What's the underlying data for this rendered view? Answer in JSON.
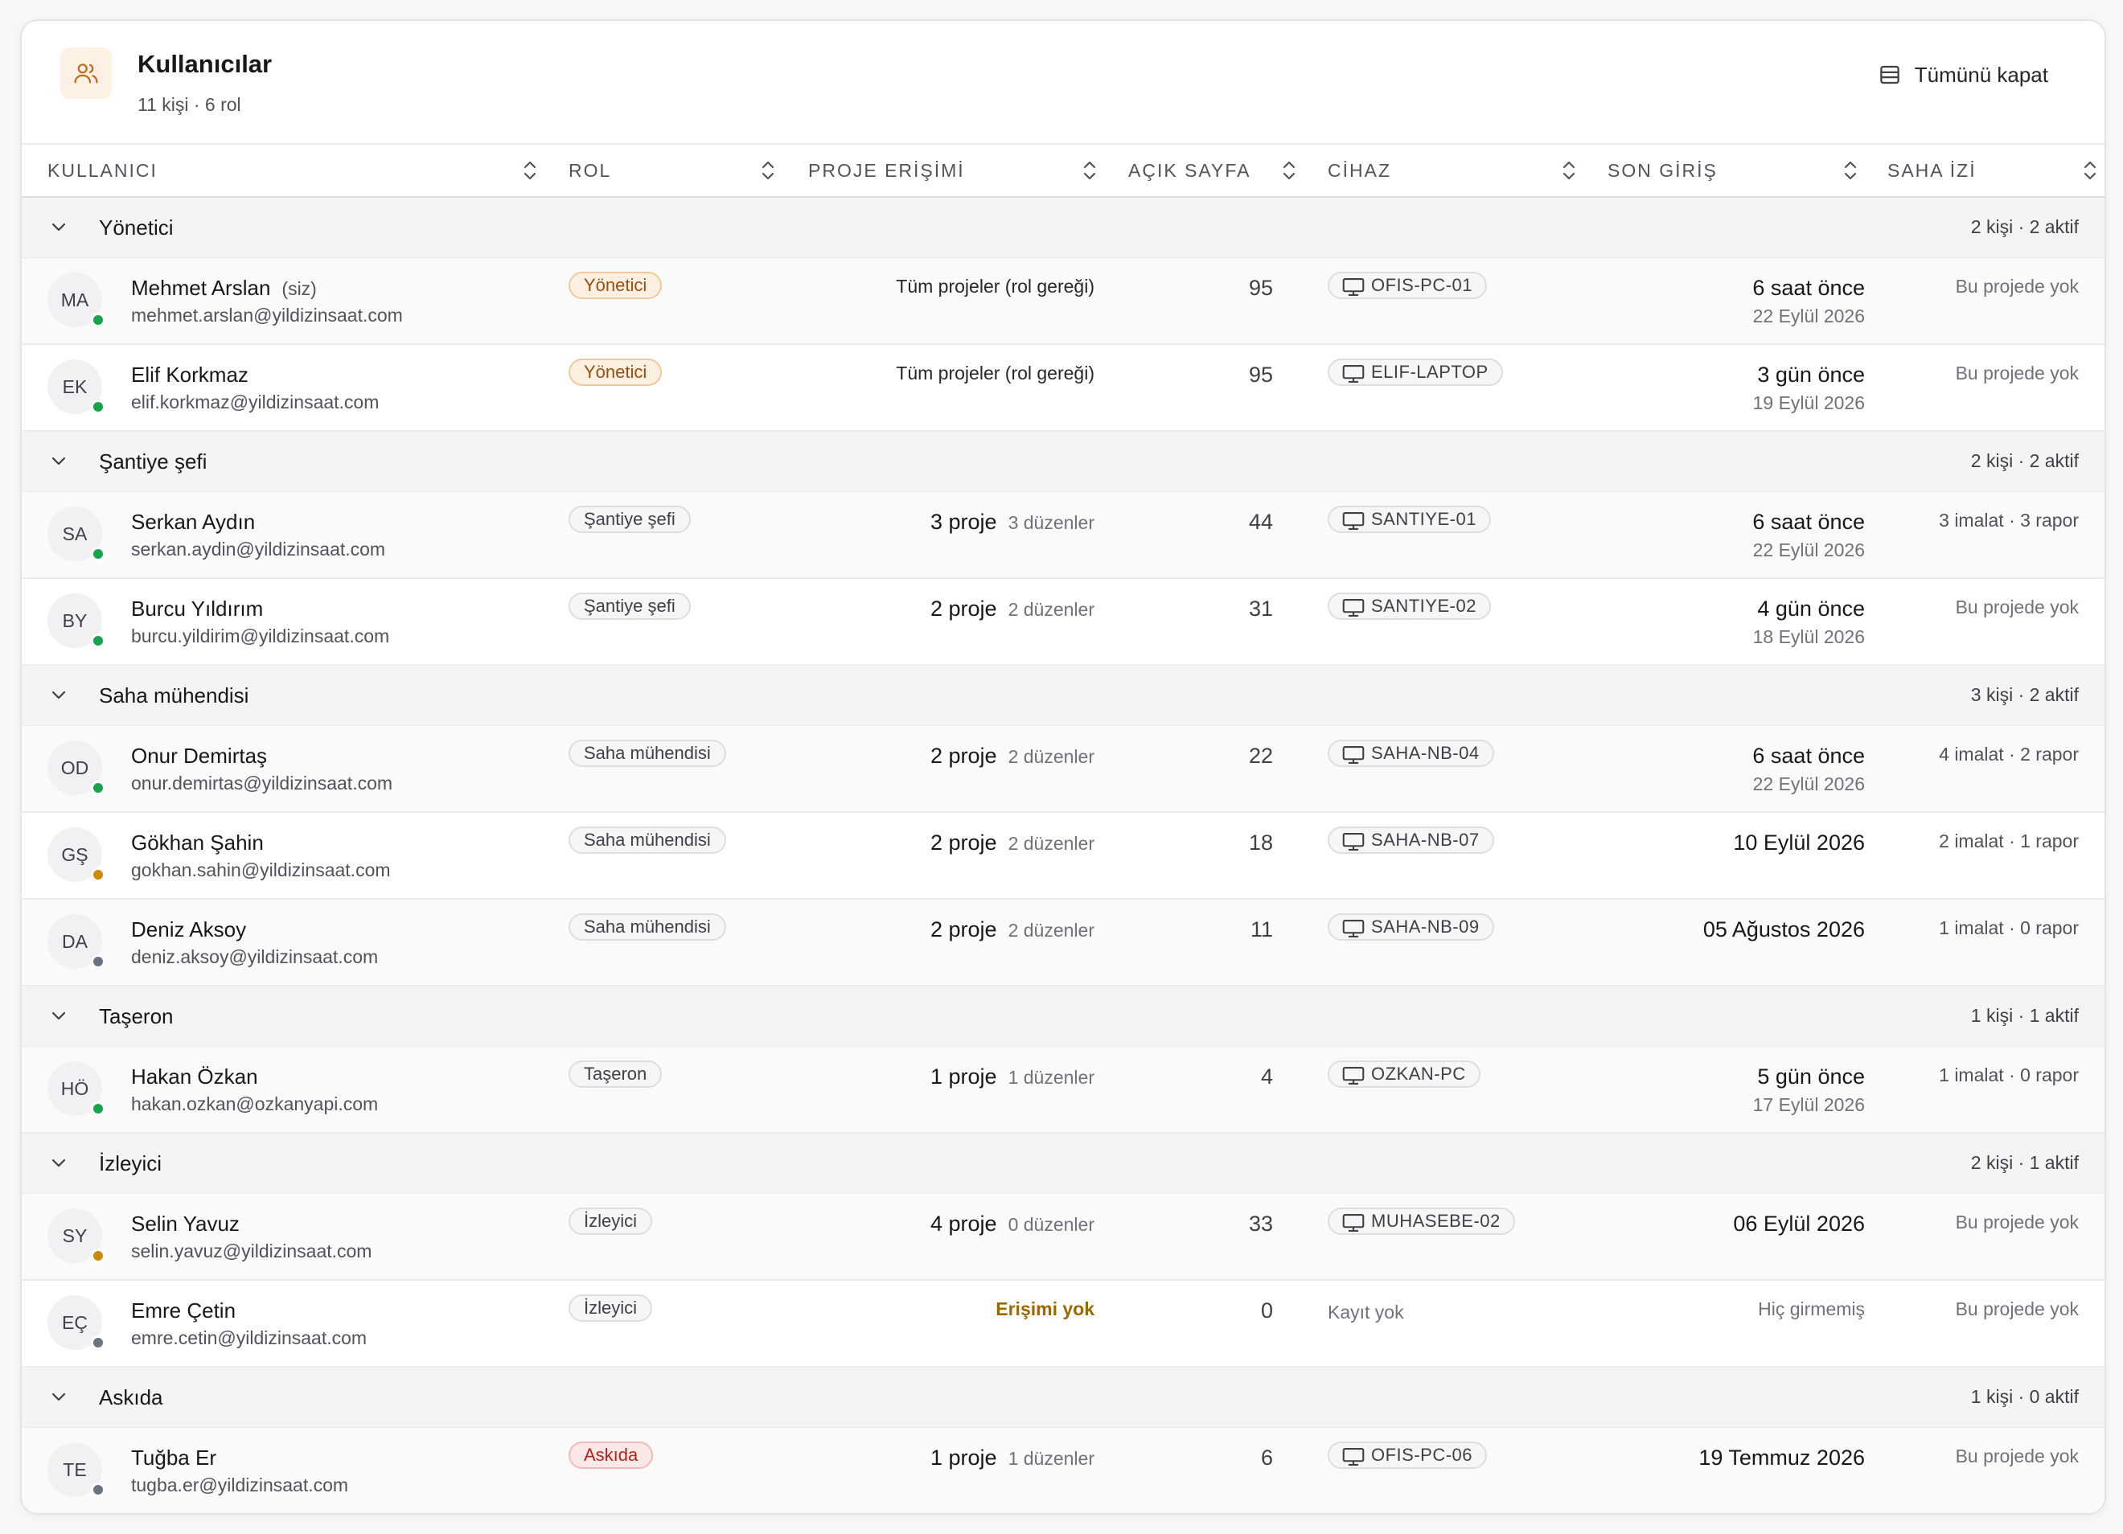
{
  "header": {
    "title": "Kullanıcılar",
    "subtitle": "11 kişi · 6 rol",
    "collapse_label": "Tümünü kapat"
  },
  "columns": [
    "KULLANICI",
    "ROL",
    "PROJE ERİŞİMİ",
    "AÇIK SAYFA",
    "CİHAZ",
    "SON GİRİŞ",
    "SAHA İZİ"
  ],
  "colors": {
    "accent": "#c2691c",
    "online": "#16a34a",
    "idle": "#ca8a04",
    "offline": "#6b7280"
  },
  "groups": [
    {
      "name": "Yönetici",
      "summary": "2 kişi · 2 aktif",
      "rows": [
        {
          "initials": "MA",
          "status": "online",
          "name": "Mehmet Arslan",
          "you": "(siz)",
          "email": "mehmet.arslan@yildizinsaat.com",
          "role": "Yönetici",
          "role_style": "admin",
          "proj_text": "Tüm projeler (rol gereği)",
          "pages": "95",
          "device": "OFIS-PC-01",
          "login_rel": "6 saat önce",
          "login_date": "22 Eylül 2026",
          "trace": "Bu projede yok"
        },
        {
          "initials": "EK",
          "status": "online",
          "name": "Elif Korkmaz",
          "email": "elif.korkmaz@yildizinsaat.com",
          "role": "Yönetici",
          "role_style": "admin",
          "proj_text": "Tüm projeler (rol gereği)",
          "pages": "95",
          "device": "ELIF-LAPTOP",
          "login_rel": "3 gün önce",
          "login_date": "19 Eylül 2026",
          "trace": "Bu projede yok"
        }
      ]
    },
    {
      "name": "Şantiye şefi",
      "summary": "2 kişi · 2 aktif",
      "rows": [
        {
          "initials": "SA",
          "status": "online",
          "name": "Serkan Aydın",
          "email": "serkan.aydin@yildizinsaat.com",
          "role": "Şantiye şefi",
          "proj_count": "3 proje",
          "proj_edit": "3 düzenler",
          "pages": "44",
          "device": "SANTIYE-01",
          "login_rel": "6 saat önce",
          "login_date": "22 Eylül 2026",
          "trace": "3 imalat · 3 rapor"
        },
        {
          "initials": "BY",
          "status": "online",
          "name": "Burcu Yıldırım",
          "email": "burcu.yildirim@yildizinsaat.com",
          "role": "Şantiye şefi",
          "proj_count": "2 proje",
          "proj_edit": "2 düzenler",
          "pages": "31",
          "device": "SANTIYE-02",
          "login_rel": "4 gün önce",
          "login_date": "18 Eylül 2026",
          "trace": "Bu projede yok"
        }
      ]
    },
    {
      "name": "Saha mühendisi",
      "summary": "3 kişi · 2 aktif",
      "rows": [
        {
          "initials": "OD",
          "status": "online",
          "name": "Onur Demirtaş",
          "email": "onur.demirtas@yildizinsaat.com",
          "role": "Saha mühendisi",
          "proj_count": "2 proje",
          "proj_edit": "2 düzenler",
          "pages": "22",
          "device": "SAHA-NB-04",
          "login_rel": "6 saat önce",
          "login_date": "22 Eylül 2026",
          "trace": "4 imalat · 2 rapor"
        },
        {
          "initials": "GŞ",
          "status": "idle",
          "name": "Gökhan Şahin",
          "email": "gokhan.sahin@yildizinsaat.com",
          "role": "Saha mühendisi",
          "proj_count": "2 proje",
          "proj_edit": "2 düzenler",
          "pages": "18",
          "device": "SAHA-NB-07",
          "login_rel": "10 Eylül 2026",
          "trace": "2 imalat · 1 rapor"
        },
        {
          "initials": "DA",
          "status": "offline",
          "name": "Deniz Aksoy",
          "email": "deniz.aksoy@yildizinsaat.com",
          "role": "Saha mühendisi",
          "proj_count": "2 proje",
          "proj_edit": "2 düzenler",
          "pages": "11",
          "device": "SAHA-NB-09",
          "login_rel": "05 Ağustos 2026",
          "trace": "1 imalat · 0 rapor"
        }
      ]
    },
    {
      "name": "Taşeron",
      "summary": "1 kişi · 1 aktif",
      "rows": [
        {
          "initials": "HÖ",
          "status": "online",
          "name": "Hakan Özkan",
          "email": "hakan.ozkan@ozkanyapi.com",
          "role": "Taşeron",
          "proj_count": "1 proje",
          "proj_edit": "1 düzenler",
          "pages": "4",
          "device": "OZKAN-PC",
          "login_rel": "5 gün önce",
          "login_date": "17 Eylül 2026",
          "trace": "1 imalat · 0 rapor"
        }
      ]
    },
    {
      "name": "İzleyici",
      "summary": "2 kişi · 1 aktif",
      "rows": [
        {
          "initials": "SY",
          "status": "idle",
          "name": "Selin Yavuz",
          "email": "selin.yavuz@yildizinsaat.com",
          "role": "İzleyici",
          "proj_count": "4 proje",
          "proj_edit": "0 düzenler",
          "pages": "33",
          "device": "MUHASEBE-02",
          "login_rel": "06 Eylül 2026",
          "trace": "Bu projede yok"
        },
        {
          "initials": "EÇ",
          "status": "offline",
          "name": "Emre Çetin",
          "email": "emre.cetin@yildizinsaat.com",
          "role": "İzleyici",
          "proj_none": "Erişimi yok",
          "pages": "0",
          "device_none": "Kayıt yok",
          "login_never": "Hiç girmemiş",
          "trace": "Bu projede yok"
        }
      ]
    },
    {
      "name": "Askıda",
      "summary": "1 kişi · 0 aktif",
      "rows": [
        {
          "initials": "TE",
          "status": "offline",
          "name": "Tuğba Er",
          "email": "tugba.er@yildizinsaat.com",
          "role": "Askıda",
          "role_style": "susp",
          "proj_count": "1 proje",
          "proj_edit": "1 düzenler",
          "pages": "6",
          "device": "OFIS-PC-06",
          "login_rel": "19 Temmuz 2026",
          "trace": "Bu projede yok"
        }
      ]
    }
  ]
}
